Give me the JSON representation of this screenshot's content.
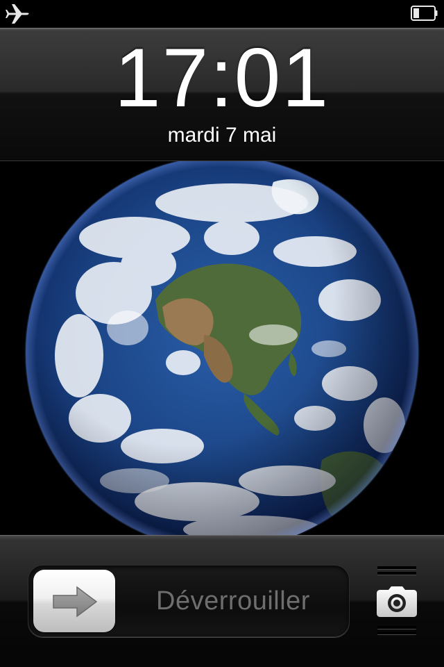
{
  "status_bar": {
    "left_icon": "airplane-icon",
    "right_icon": "battery-icon",
    "battery_level": 0.3
  },
  "clock": {
    "time": "17:01",
    "date": "mardi 7 mai"
  },
  "wallpaper": {
    "subject": "earth-globe"
  },
  "unlock": {
    "label": "Déverrouiller",
    "knob_icon": "arrow-right-icon"
  },
  "camera": {
    "icon": "camera-icon"
  },
  "colors": {
    "background": "#000000",
    "label_gray": "#6e6e6e",
    "ocean": "#1d4a8c"
  }
}
